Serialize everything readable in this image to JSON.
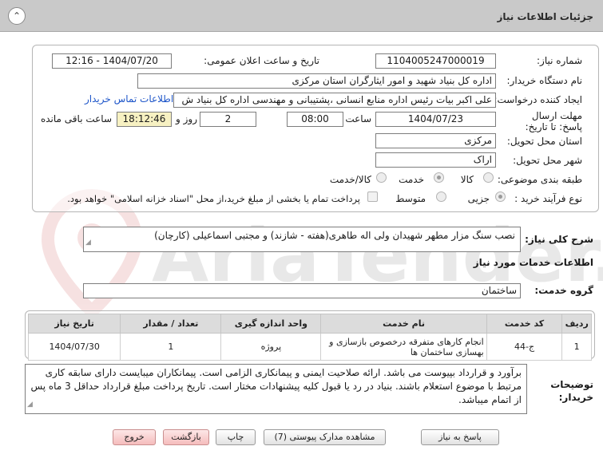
{
  "header": {
    "title": "جزئیات اطلاعات نیاز",
    "collapse_icon": "chevron-up-icon"
  },
  "details": {
    "need_number": {
      "label": "شماره نیاز:",
      "value": "1104005247000019"
    },
    "announce_datetime": {
      "label": "تاریخ و ساعت اعلان عمومی:",
      "value": "1404/07/20 - 12:16"
    },
    "buyer_org": {
      "label": "نام دستگاه خریدار:",
      "value": "اداره کل بنیاد شهید و امور ایثارگران استان مرکزی"
    },
    "creator": {
      "label": "ایجاد کننده درخواست:",
      "value": "علی اکبر بیات رئیس اداره منابع انسانی ،پشتیبانی و مهندسی اداره کل بنیاد ش"
    },
    "contact_link": "اطلاعات تماس خریدار",
    "deadline": {
      "label": "مهلت ارسال پاسخ: تا تاریخ:",
      "date": "1404/07/23",
      "time_label": "ساعت",
      "time": "08:00",
      "days": "2",
      "days_label": "روز و",
      "remaining": "18:12:46",
      "remaining_label": "ساعت باقی مانده"
    },
    "province": {
      "label": "استان محل تحویل:",
      "value": "مرکزی"
    },
    "city": {
      "label": "شهر محل تحویل:",
      "value": "اراک"
    },
    "category": {
      "label": "طبقه بندی موضوعی:",
      "options": [
        "کالا",
        "خدمت",
        "کالا/خدمت"
      ],
      "selected": "خدمت"
    },
    "purchase_type": {
      "label": "نوع فرآیند خرید :",
      "options": [
        "جزیی",
        "متوسط"
      ],
      "selected": "جزیی",
      "payment_note": "پرداخت تمام یا بخشی از مبلغ خرید،از محل \"اسناد خزانه اسلامی\" خواهد بود."
    }
  },
  "summary": {
    "label": "شرح کلی نیاز:",
    "value": "نصب سنگ مزار مطهر شهیدان ولی اله طاهری(هفته - شازند) و مجتبی اسماعیلی (کارچان)"
  },
  "services": {
    "section_title": "اطلاعات خدمات مورد نیاز",
    "group_label": "گروه خدمت:",
    "group_value": "ساختمان",
    "table": {
      "headers": [
        "ردیف",
        "کد خدمت",
        "نام خدمت",
        "واحد اندازه گیری",
        "تعداد / مقدار",
        "تاریخ نیاز"
      ],
      "rows": [
        [
          "1",
          "ج-44",
          "انجام کارهای متفرقه درخصوص بازسازی و بهسازی ساختمان ها",
          "پروژه",
          "1",
          "1404/07/30"
        ]
      ]
    }
  },
  "buyer_notes": {
    "label": "توضیحات خریدار:",
    "value": "برآورد و قرارداد بپیوست می باشد. ارائه صلاحیت ایمنی و پیمانکاری الزامی است. پیمانکاران میبایست دارای سابقه کاری مرتبط با موضوع استعلام باشند. بنیاد در رد یا قبول کلیه پیشنهادات مختار است. تاریخ پرداخت مبلغ قرارداد حداقل 3 ماه پس از اتمام میباشد."
  },
  "actions": {
    "reply": "پاسخ به نیاز",
    "view_docs": "مشاهده مدارک پیوستی (7)",
    "print": "چاپ",
    "back": "بازگشت",
    "exit": "خروج"
  },
  "watermark": {
    "brand": "AriaTender.neT"
  }
}
